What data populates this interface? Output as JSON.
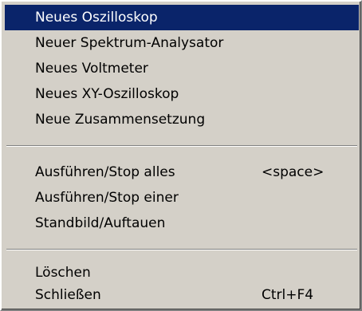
{
  "menu": {
    "group1": [
      {
        "label": "Neues Oszilloskop",
        "selected": true
      },
      {
        "label": "Neuer Spektrum-Analysator"
      },
      {
        "label": "Neues Voltmeter"
      },
      {
        "label": "Neues XY-Oszilloskop"
      },
      {
        "label": "Neue Zusammensetzung"
      }
    ],
    "group2": [
      {
        "label": "Ausführen/Stop alles",
        "shortcut": "<space>"
      },
      {
        "label": "Ausführen/Stop einer"
      },
      {
        "label": "Standbild/Auftauen"
      }
    ],
    "group3": [
      {
        "label": "Löschen"
      },
      {
        "label": "Schließen",
        "shortcut": "Ctrl+F4"
      }
    ]
  },
  "colors": {
    "menu_background": "#d4d0c8",
    "highlight_background": "#0a246a",
    "highlight_text": "#ffffff"
  }
}
